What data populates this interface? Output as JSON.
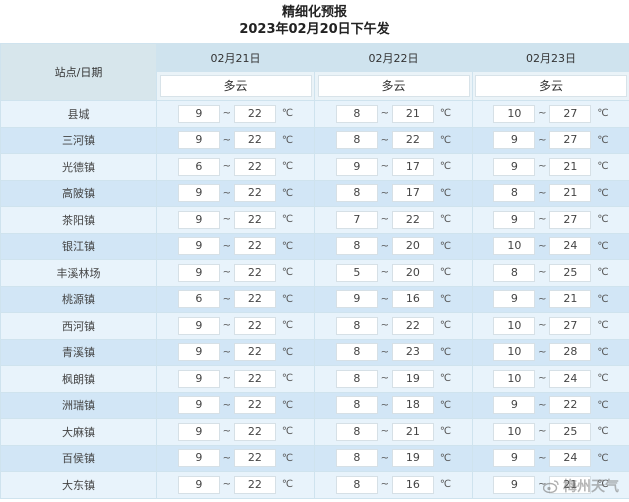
{
  "title": "精细化预报",
  "subtitle": "2023年02月20日下午发",
  "header": {
    "station_label": "站点/日期",
    "temp_separator": "~",
    "unit": "℃"
  },
  "days": [
    {
      "date": "02月21日",
      "weather": "多云"
    },
    {
      "date": "02月22日",
      "weather": "多云"
    },
    {
      "date": "02月23日",
      "weather": "多云"
    }
  ],
  "rows": [
    {
      "station": "县城",
      "temps": [
        [
          "9",
          "22"
        ],
        [
          "8",
          "21"
        ],
        [
          "10",
          "27"
        ]
      ]
    },
    {
      "station": "三河镇",
      "temps": [
        [
          "9",
          "22"
        ],
        [
          "8",
          "22"
        ],
        [
          "9",
          "27"
        ]
      ]
    },
    {
      "station": "光德镇",
      "temps": [
        [
          "6",
          "22"
        ],
        [
          "9",
          "17"
        ],
        [
          "9",
          "21"
        ]
      ]
    },
    {
      "station": "高陂镇",
      "temps": [
        [
          "9",
          "22"
        ],
        [
          "8",
          "17"
        ],
        [
          "8",
          "21"
        ]
      ]
    },
    {
      "station": "茶阳镇",
      "temps": [
        [
          "9",
          "22"
        ],
        [
          "7",
          "22"
        ],
        [
          "9",
          "27"
        ]
      ]
    },
    {
      "station": "银江镇",
      "temps": [
        [
          "9",
          "22"
        ],
        [
          "8",
          "20"
        ],
        [
          "10",
          "24"
        ]
      ]
    },
    {
      "station": "丰溪林场",
      "temps": [
        [
          "9",
          "22"
        ],
        [
          "5",
          "20"
        ],
        [
          "8",
          "25"
        ]
      ]
    },
    {
      "station": "桃源镇",
      "temps": [
        [
          "6",
          "22"
        ],
        [
          "9",
          "16"
        ],
        [
          "9",
          "21"
        ]
      ]
    },
    {
      "station": "西河镇",
      "temps": [
        [
          "9",
          "22"
        ],
        [
          "8",
          "22"
        ],
        [
          "10",
          "27"
        ]
      ]
    },
    {
      "station": "青溪镇",
      "temps": [
        [
          "9",
          "22"
        ],
        [
          "8",
          "23"
        ],
        [
          "10",
          "28"
        ]
      ]
    },
    {
      "station": "枫朗镇",
      "temps": [
        [
          "9",
          "22"
        ],
        [
          "8",
          "19"
        ],
        [
          "10",
          "24"
        ]
      ]
    },
    {
      "station": "洲瑞镇",
      "temps": [
        [
          "9",
          "22"
        ],
        [
          "8",
          "18"
        ],
        [
          "9",
          "22"
        ]
      ]
    },
    {
      "station": "大麻镇",
      "temps": [
        [
          "9",
          "22"
        ],
        [
          "8",
          "21"
        ],
        [
          "10",
          "25"
        ]
      ]
    },
    {
      "station": "百侯镇",
      "temps": [
        [
          "9",
          "22"
        ],
        [
          "8",
          "19"
        ],
        [
          "9",
          "24"
        ]
      ]
    },
    {
      "station": "大东镇",
      "temps": [
        [
          "9",
          "22"
        ],
        [
          "8",
          "16"
        ],
        [
          "9",
          "21"
        ]
      ]
    }
  ],
  "watermark": "梅州天气"
}
